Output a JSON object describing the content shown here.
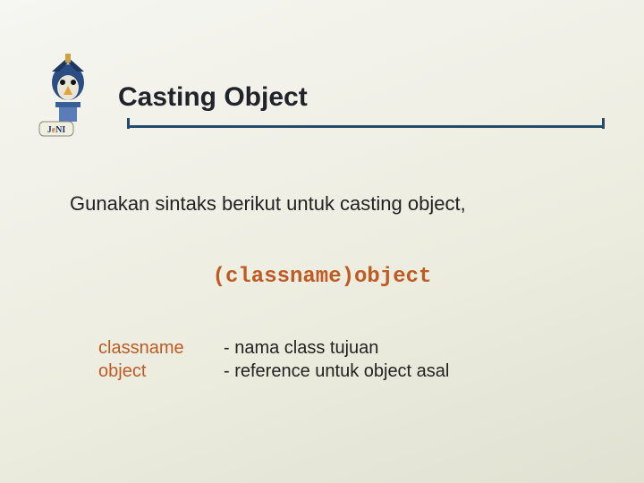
{
  "logo": {
    "alt": "JENI mascot logo",
    "label_text": "JeNI"
  },
  "title": "Casting Object",
  "intro": "Gunakan sintaks berikut untuk casting object,",
  "code": "(classname)object",
  "defs": [
    {
      "term": "classname",
      "desc": "- nama class tujuan"
    },
    {
      "term": "object",
      "desc": "- reference untuk object asal"
    }
  ]
}
